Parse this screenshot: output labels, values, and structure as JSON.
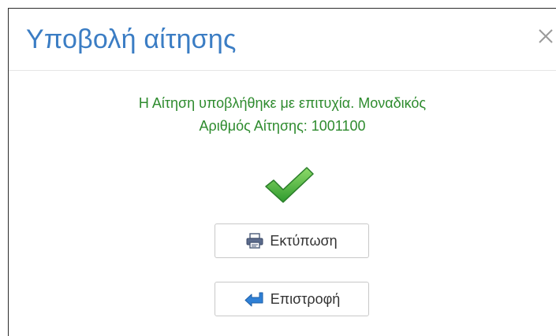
{
  "dialog": {
    "title": "Υποβολή αίτησης",
    "close_icon": "close-icon",
    "message_line1": "Η Αίτηση υποβλήθηκε με επιτυχία. Μοναδικός",
    "message_line2": "Αριθμός Αίτησης: 1001100",
    "success_icon": "checkmark-icon",
    "print_label": "Εκτύπωση",
    "print_icon": "printer-icon",
    "back_label": "Επιστροφή",
    "back_icon": "return-arrow-icon"
  },
  "colors": {
    "title": "#3b7dc4",
    "message": "#2e8b2e",
    "check": "#3fa93f",
    "accent_blue": "#2f80d6"
  }
}
